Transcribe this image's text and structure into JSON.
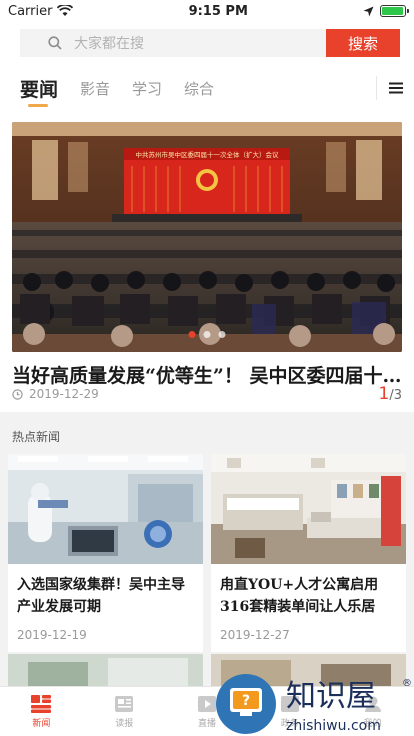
{
  "status_bar": {
    "carrier": "Carrier",
    "time": "9:15 PM",
    "battery_level": 0.95
  },
  "search": {
    "placeholder": "大家都在搜",
    "button_label": "搜索"
  },
  "tabs": [
    {
      "label": "要闻",
      "active": true
    },
    {
      "label": "影音",
      "active": false
    },
    {
      "label": "学习",
      "active": false
    },
    {
      "label": "综合",
      "active": false
    }
  ],
  "feature": {
    "banner_text": "中共苏州市吴中区委四届十一次全体（扩大）会议",
    "title": "当好高质量发展“优等生”！ 吴中区委四届十一次全体（扩大）会议召开",
    "date": "2019-12-29",
    "current_page": "1",
    "total_pages": "/3",
    "active_slide": 0
  },
  "hot_news": {
    "heading": "热点新闻",
    "items": [
      {
        "title": "入选国家级集群！吴中主导产业发展可期",
        "date": "2019-12-19"
      },
      {
        "title": "甪直YOU+人才公寓启用 316套精装单间让人乐居",
        "date": "2019-12-27"
      }
    ]
  },
  "bottom_nav": [
    {
      "label": "新闻",
      "icon": "news-icon",
      "active": true
    },
    {
      "label": "读报",
      "icon": "newspaper-icon",
      "active": false
    },
    {
      "label": "直播",
      "icon": "play-icon",
      "active": false
    },
    {
      "label": "政务",
      "icon": "service-icon",
      "active": false
    },
    {
      "label": "我的",
      "icon": "user-icon",
      "active": false
    }
  ],
  "watermark": {
    "brand": "知识屋",
    "domain": "zhishiwu.com"
  },
  "colors": {
    "accent": "#e8412c",
    "tab_underline": "#f0a84a",
    "banner_red": "#d8261c"
  }
}
